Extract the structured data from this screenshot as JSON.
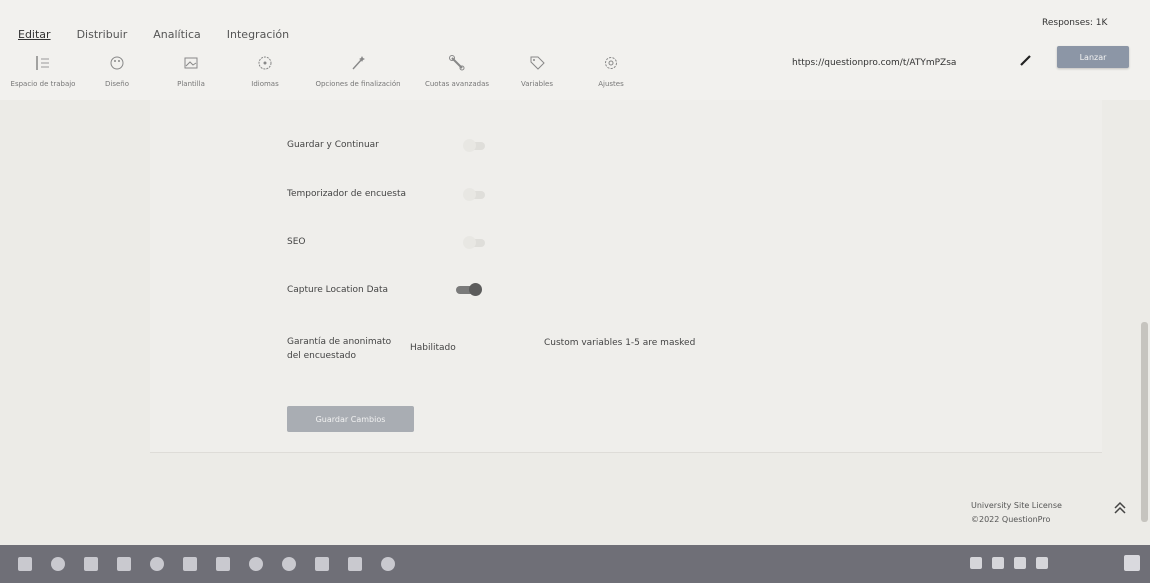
{
  "nav": {
    "tabs": [
      {
        "label": "Editar"
      },
      {
        "label": "Distribuir"
      },
      {
        "label": "Analítica"
      },
      {
        "label": "Integración"
      }
    ]
  },
  "toolbar": {
    "items": [
      {
        "label": "Espacio de trabajo",
        "icon": "list-icon"
      },
      {
        "label": "Diseño",
        "icon": "palette-icon"
      },
      {
        "label": "Plantilla",
        "icon": "image-icon"
      },
      {
        "label": "Idiomas",
        "icon": "globe-icon"
      },
      {
        "label": "Opciones de finalización",
        "icon": "wand-icon"
      },
      {
        "label": "Cuotas avanzadas",
        "icon": "wrench-icon"
      },
      {
        "label": "Variables",
        "icon": "tag-icon"
      },
      {
        "label": "Ajustes",
        "icon": "gear-icon"
      }
    ]
  },
  "header": {
    "url": "https://questionpro.com/t/ATYmPZsa",
    "launch_label": "Lanzar",
    "responses": "Responses: 1K"
  },
  "settings": {
    "rows": [
      {
        "label": "Guardar y Continuar",
        "state": "off"
      },
      {
        "label": "Temporizador de encuesta",
        "state": "off"
      },
      {
        "label": "SEO",
        "state": "off"
      },
      {
        "label": "Capture Location Data",
        "state": "on"
      }
    ],
    "anonymity": {
      "label_line1": "Garantía de anonimato",
      "label_line2": "del encuestado",
      "value": "Habilitado",
      "note": "Custom variables 1-5 are masked"
    },
    "save_label": "Guardar Cambios"
  },
  "footer": {
    "license": "University Site License",
    "copyright": "©2022 QuestionPro"
  },
  "colors": {
    "accent": "#8c96a6",
    "toggle_on": "#5c5c5c",
    "taskbar": "#6f6f77"
  }
}
